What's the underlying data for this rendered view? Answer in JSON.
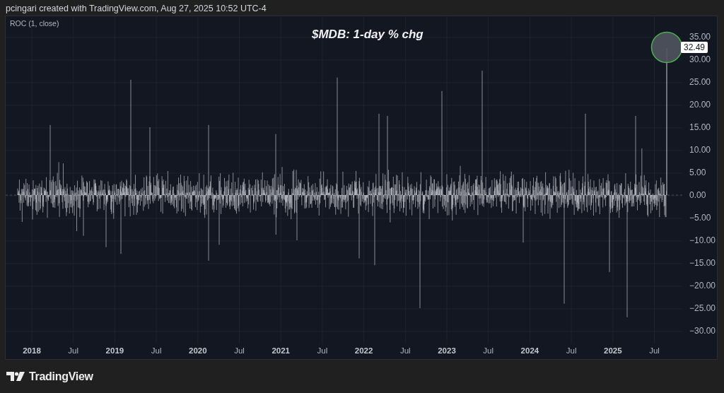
{
  "header": {
    "text": "pcingari created with TradingView.com, Aug 27, 2025 10:52 UTC-4"
  },
  "chart": {
    "legend": "ROC (1, close)",
    "title": "$MDB: 1-day % chg",
    "price_labels": [
      "35.00",
      "30.00",
      "25.00",
      "20.00",
      "15.00",
      "10.00",
      "5.00",
      "0.00",
      "−5.00",
      "−10.00",
      "−15.00",
      "−20.00",
      "−25.00",
      "−30.00"
    ],
    "last_value": {
      "label": "32.49"
    },
    "time_labels": [
      {
        "label": "2018",
        "kind": "year"
      },
      {
        "label": "Jul",
        "kind": "month"
      },
      {
        "label": "2019",
        "kind": "year"
      },
      {
        "label": "Jul",
        "kind": "month"
      },
      {
        "label": "2020",
        "kind": "year"
      },
      {
        "label": "Jul",
        "kind": "month"
      },
      {
        "label": "2021",
        "kind": "year"
      },
      {
        "label": "Jul",
        "kind": "month"
      },
      {
        "label": "2022",
        "kind": "year"
      },
      {
        "label": "Jul",
        "kind": "month"
      },
      {
        "label": "2023",
        "kind": "year"
      },
      {
        "label": "Jul",
        "kind": "month"
      },
      {
        "label": "2024",
        "kind": "year"
      },
      {
        "label": "Jul",
        "kind": "month"
      },
      {
        "label": "2025",
        "kind": "year"
      },
      {
        "label": "Jul",
        "kind": "month"
      }
    ]
  },
  "brand": {
    "name": "TradingView"
  }
}
